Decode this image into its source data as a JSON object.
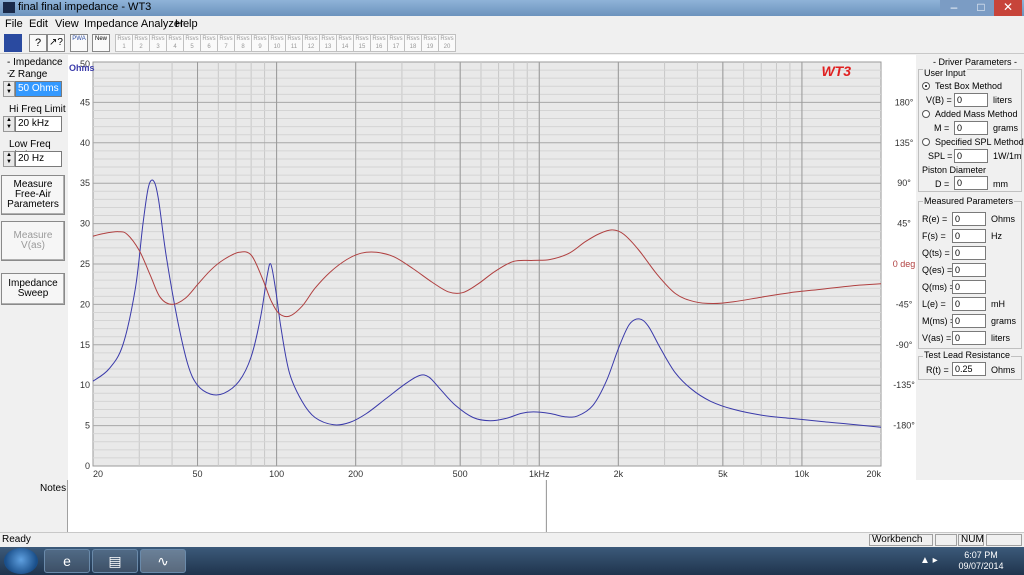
{
  "window": {
    "title": "final final impedance - WT3"
  },
  "menu": [
    "File",
    "Edit",
    "View",
    "Impedance Analyzer",
    "Help"
  ],
  "toolbar": {
    "pwa_label": "PWA",
    "new_label": "New",
    "slot_label": "Rsvs",
    "slot_numbers": [
      "1",
      "2",
      "3",
      "4",
      "5",
      "6",
      "7",
      "8",
      "9",
      "10",
      "11",
      "12",
      "13",
      "14",
      "15",
      "16",
      "17",
      "18",
      "19",
      "20"
    ]
  },
  "impedance": {
    "group_title": "- Impedance -",
    "z_range_label": "Z Range",
    "z_range_value": "50 Ohms",
    "hi_freq_label": "Hi Freq Limit",
    "hi_freq_value": "20 kHz",
    "low_freq_label": "Low Freq Limit",
    "low_freq_value": "20 Hz"
  },
  "buttons": {
    "measure_free_air": "Measure Free-Air Parameters",
    "measure_vas": "Measure V(as)",
    "impedance_sweep": "Impedance Sweep"
  },
  "chart_data": {
    "type": "line",
    "brand_label": "WT3",
    "x_scale": "log",
    "xlim": [
      20,
      20000
    ],
    "x_ticks": [
      {
        "v": 20,
        "label": "20"
      },
      {
        "v": 50,
        "label": "50"
      },
      {
        "v": 100,
        "label": "100"
      },
      {
        "v": 200,
        "label": "200"
      },
      {
        "v": 500,
        "label": "500"
      },
      {
        "v": 1000,
        "label": "1kHz"
      },
      {
        "v": 2000,
        "label": "2k"
      },
      {
        "v": 5000,
        "label": "5k"
      },
      {
        "v": 10000,
        "label": "10k"
      },
      {
        "v": 20000,
        "label": "20k"
      }
    ],
    "y_left": {
      "label": "Ohms",
      "lim": [
        0,
        50
      ],
      "ticks": [
        0,
        5,
        10,
        15,
        20,
        25,
        30,
        35,
        40,
        45,
        50
      ]
    },
    "y_right": {
      "lim": [
        -225,
        225
      ],
      "ticks": [
        {
          "v": 180,
          "label": "180°"
        },
        {
          "v": 135,
          "label": "135°"
        },
        {
          "v": 90,
          "label": "90°"
        },
        {
          "v": 45,
          "label": "45°"
        },
        {
          "v": 0,
          "label": "0 deg"
        },
        {
          "v": -45,
          "label": "-45°"
        },
        {
          "v": -90,
          "label": "-90°"
        },
        {
          "v": -135,
          "label": "-135°"
        },
        {
          "v": -180,
          "label": "-180°"
        }
      ]
    },
    "grid": true,
    "series": [
      {
        "color": "#3a3aaa",
        "axis": "left",
        "points": [
          [
            20,
            10.5
          ],
          [
            23,
            12
          ],
          [
            26,
            15
          ],
          [
            29,
            22
          ],
          [
            31,
            30
          ],
          [
            32.5,
            34.5
          ],
          [
            34,
            35.3
          ],
          [
            35.5,
            33
          ],
          [
            38,
            26
          ],
          [
            42,
            18
          ],
          [
            46,
            12.5
          ],
          [
            50,
            10
          ],
          [
            56,
            8.9
          ],
          [
            63,
            9
          ],
          [
            72,
            10.5
          ],
          [
            80,
            13.5
          ],
          [
            87,
            18.5
          ],
          [
            92,
            23.5
          ],
          [
            95,
            25
          ],
          [
            99,
            22
          ],
          [
            104,
            17
          ],
          [
            112,
            11.5
          ],
          [
            125,
            8
          ],
          [
            140,
            6
          ],
          [
            165,
            5.1
          ],
          [
            190,
            5.4
          ],
          [
            220,
            6.5
          ],
          [
            260,
            8.3
          ],
          [
            310,
            10.2
          ],
          [
            350,
            11.2
          ],
          [
            380,
            11
          ],
          [
            420,
            9.5
          ],
          [
            480,
            7.5
          ],
          [
            560,
            6
          ],
          [
            650,
            5.6
          ],
          [
            750,
            5.9
          ],
          [
            850,
            6.5
          ],
          [
            950,
            6.7
          ],
          [
            1100,
            6.5
          ],
          [
            1250,
            6.1
          ],
          [
            1400,
            6.2
          ],
          [
            1600,
            7.5
          ],
          [
            1800,
            10.5
          ],
          [
            2000,
            14.5
          ],
          [
            2200,
            17.5
          ],
          [
            2400,
            18.2
          ],
          [
            2600,
            17.3
          ],
          [
            2900,
            14.5
          ],
          [
            3300,
            11.5
          ],
          [
            3800,
            9.5
          ],
          [
            4500,
            8
          ],
          [
            5500,
            7
          ],
          [
            7000,
            6.3
          ],
          [
            9000,
            5.9
          ],
          [
            12000,
            5.5
          ],
          [
            15000,
            5.2
          ],
          [
            20000,
            4.8
          ]
        ]
      },
      {
        "color": "#b04040",
        "axis": "right",
        "points": [
          [
            20,
            31
          ],
          [
            22,
            34
          ],
          [
            25,
            36
          ],
          [
            27,
            33
          ],
          [
            30,
            15
          ],
          [
            33,
            -12
          ],
          [
            36,
            -37
          ],
          [
            40,
            -45
          ],
          [
            45,
            -38
          ],
          [
            50,
            -23
          ],
          [
            56,
            -7
          ],
          [
            63,
            5
          ],
          [
            72,
            13
          ],
          [
            80,
            10
          ],
          [
            88,
            -15
          ],
          [
            95,
            -40
          ],
          [
            102,
            -55
          ],
          [
            112,
            -58
          ],
          [
            125,
            -47
          ],
          [
            140,
            -27
          ],
          [
            160,
            -9
          ],
          [
            185,
            5
          ],
          [
            210,
            12
          ],
          [
            240,
            13
          ],
          [
            280,
            8
          ],
          [
            330,
            -5
          ],
          [
            390,
            -20
          ],
          [
            450,
            -31
          ],
          [
            510,
            -32
          ],
          [
            580,
            -23
          ],
          [
            680,
            -8
          ],
          [
            800,
            3
          ],
          [
            950,
            4
          ],
          [
            1100,
            5
          ],
          [
            1300,
            12
          ],
          [
            1500,
            25
          ],
          [
            1700,
            34
          ],
          [
            1900,
            38
          ],
          [
            2100,
            33
          ],
          [
            2400,
            15
          ],
          [
            2800,
            -11
          ],
          [
            3300,
            -33
          ],
          [
            3900,
            -42
          ],
          [
            4600,
            -44
          ],
          [
            5500,
            -42
          ],
          [
            7000,
            -37
          ],
          [
            9000,
            -32
          ],
          [
            12000,
            -28
          ],
          [
            16000,
            -24
          ],
          [
            20000,
            -22
          ]
        ]
      }
    ]
  },
  "driver_params": {
    "title": "- Driver Parameters -",
    "user_input_title": "User Input",
    "test_box": "Test Box Method",
    "vb_label": "V(B) =",
    "vb_value": "0",
    "vb_unit": "liters",
    "added_mass": "Added Mass Method",
    "m_label": "M =",
    "m_value": "0",
    "m_unit": "grams",
    "spl_method": "Specified SPL Method",
    "spl_label": "SPL =",
    "spl_value": "0",
    "spl_unit": "1W/1m",
    "piston_title": "Piston Diameter",
    "d_label": "D =",
    "d_value": "0",
    "d_unit": "mm"
  },
  "measured_params": {
    "title": "Measured Parameters",
    "rows": [
      {
        "label": "R(e) =",
        "value": "0",
        "unit": "Ohms"
      },
      {
        "label": "F(s) =",
        "value": "0",
        "unit": "Hz"
      },
      {
        "label": "Q(ts) =",
        "value": "0",
        "unit": ""
      },
      {
        "label": "Q(es) =",
        "value": "0",
        "unit": ""
      },
      {
        "label": "Q(ms) =",
        "value": "0",
        "unit": ""
      },
      {
        "label": "L(e) =",
        "value": "0",
        "unit": "mH"
      },
      {
        "label": "M(ms) =",
        "value": "0",
        "unit": "grams"
      },
      {
        "label": "V(as) =",
        "value": "0",
        "unit": "liters"
      }
    ]
  },
  "test_lead": {
    "title": "Test Lead Resistance",
    "label": "R(t) =",
    "value": "0.25",
    "unit": "Ohms"
  },
  "notes": {
    "label": "Notes:"
  },
  "status": {
    "ready": "Ready",
    "workbench": "Workbench",
    "num": "NUM"
  },
  "taskbar": {
    "time": "6:07 PM",
    "date": "09/07/2014"
  }
}
